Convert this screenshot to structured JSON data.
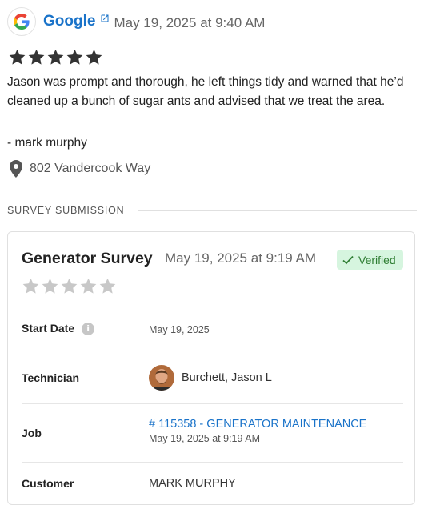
{
  "review": {
    "source": "Google",
    "source_icon": "google-logo-icon",
    "external_icon": "external-link-icon",
    "date": "May 19, 2025 at 9:40 AM",
    "rating": 5,
    "text": "Jason was prompt and thorough, he left things tidy and warned that he’d cleaned up a bunch of sugar ants and advised that we treat the area.",
    "author": "- mark murphy",
    "address_icon": "location-pin-icon",
    "address": "802 Vandercook Way"
  },
  "section": {
    "title": "SURVEY SUBMISSION"
  },
  "survey": {
    "title": "Generator Survey",
    "date": "May 19, 2025 at 9:19 AM",
    "badge": "Verified",
    "badge_icon": "check-icon",
    "rating": 0,
    "rows": {
      "start_date": {
        "label": "Start Date",
        "value": "May 19, 2025",
        "icon": "info-icon"
      },
      "technician": {
        "label": "Technician",
        "value": "Burchett, Jason L"
      },
      "job": {
        "label": "Job",
        "link": "# 115358 - GENERATOR MAINTENANCE",
        "date": "May 19, 2025 at 9:19 AM"
      },
      "customer": {
        "label": "Customer",
        "value": "MARK MURPHY"
      }
    }
  },
  "colors": {
    "link": "#1a73c9",
    "star_filled": "#333333",
    "star_empty": "#c8c8c8",
    "verified_bg": "#d6f5df",
    "verified_text": "#2e7d32"
  }
}
